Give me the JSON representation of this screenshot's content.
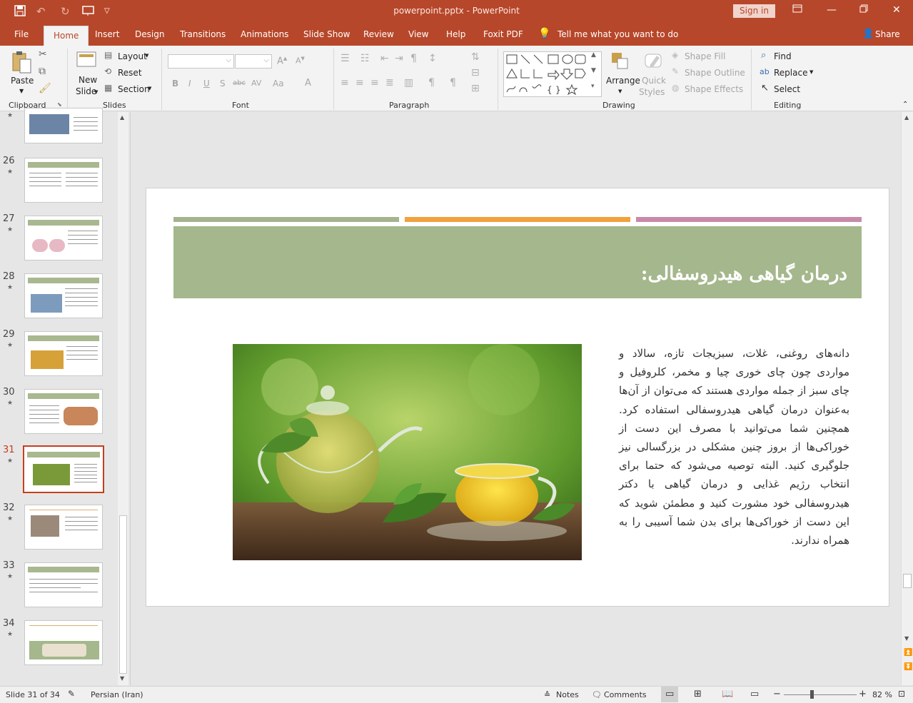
{
  "app": {
    "doc_title": "powerpoint.pptx - PowerPoint",
    "sign_in": "Sign in",
    "share": "Share",
    "tell_me": "Tell me what you want to do"
  },
  "tabs": [
    "File",
    "Home",
    "Insert",
    "Design",
    "Transitions",
    "Animations",
    "Slide Show",
    "Review",
    "View",
    "Help",
    "Foxit PDF"
  ],
  "ribbon": {
    "clipboard": {
      "paste": "Paste",
      "label": "Clipboard"
    },
    "slides": {
      "new_slide_1": "New",
      "new_slide_2": "Slide",
      "layout": "Layout",
      "reset": "Reset",
      "section": "Section",
      "label": "Slides"
    },
    "font": {
      "label": "Font",
      "bold": "B",
      "italic": "I",
      "underline": "U",
      "shadow": "S",
      "strike": "abc",
      "case": "Aa",
      "color": "A"
    },
    "paragraph": {
      "label": "Paragraph"
    },
    "drawing": {
      "arrange": "Arrange",
      "quick_1": "Quick",
      "quick_2": "Styles",
      "shape_fill": "Shape Fill",
      "shape_outline": "Shape Outline",
      "shape_effects": "Shape Effects",
      "label": "Drawing"
    },
    "editing": {
      "find": "Find",
      "replace": "Replace",
      "select": "Select",
      "label": "Editing"
    }
  },
  "thumbnails": [
    {
      "num": "26"
    },
    {
      "num": "27"
    },
    {
      "num": "28"
    },
    {
      "num": "29"
    },
    {
      "num": "30"
    },
    {
      "num": "31",
      "selected": true
    },
    {
      "num": "32"
    },
    {
      "num": "33"
    },
    {
      "num": "34"
    }
  ],
  "slide": {
    "title": "درمان گیاهی هیدروسفالی:",
    "body": "دانه‌های روغنی، غلات، سبزیجات تازه، سالاد و مواردی چون چای خوری چیا و مخمر، کلروفیل و چای سبز از جمله مواردی هستند که می‌توان از آن‌ها به‌عنوان درمان گیاهی هیدروسفالی استفاده کرد. همچنین شما می‌توانید با مصرف این دست از خوراکی‌ها از بروز چنین مشکلی در بزرگسالی نیز جلوگیری کنید. البته توصیه می‌شود که حتما برای انتخاب رژیم غذایی و درمان گیاهی با دکتر هیدروسفالی خود مشورت کنید و مطمئن شوید که این دست از خوراکی‌ها برای بدن شما آسیبی را به همراه ندارند.",
    "stripe_colors": [
      "#a5b38e",
      "#f0a23e",
      "#c98aa8"
    ],
    "band_color": "#a5b78c"
  },
  "status": {
    "slide_of": "Slide 31 of 34",
    "language": "Persian (Iran)",
    "notes": "Notes",
    "comments": "Comments",
    "zoom": "82 %"
  },
  "colors": {
    "accent": "#b7472a",
    "selected_thumb": "#c43e1c"
  }
}
